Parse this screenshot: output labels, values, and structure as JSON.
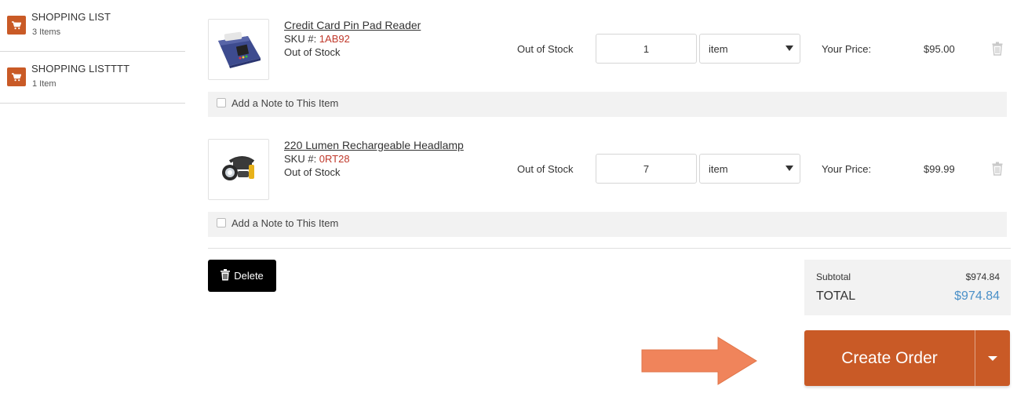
{
  "sidebar": {
    "lists": [
      {
        "name": "SHOPPING LIST",
        "count": "3 Items"
      },
      {
        "name": "SHOPPING LISTTTT",
        "count": "1 Item"
      }
    ]
  },
  "items": [
    {
      "title": "Credit Card Pin Pad Reader",
      "sku_label": "SKU #: ",
      "sku": "1AB92",
      "stock_status": "Out of Stock",
      "stock_column": "Out of Stock",
      "quantity": "1",
      "unit": "item",
      "price_label": "Your Price:",
      "price": "$95.00",
      "note_label": "Add a Note to This Item"
    },
    {
      "title": "220 Lumen Rechargeable Headlamp",
      "sku_label": "SKU #: ",
      "sku": "0RT28",
      "stock_status": "Out of Stock",
      "stock_column": "Out of Stock",
      "quantity": "7",
      "unit": "item",
      "price_label": "Your Price:",
      "price": "$99.99",
      "note_label": "Add a Note to This Item"
    }
  ],
  "actions": {
    "delete_label": "Delete",
    "create_order_label": "Create Order"
  },
  "totals": {
    "subtotal_label": "Subtotal",
    "subtotal": "$974.84",
    "total_label": "TOTAL",
    "total": "$974.84"
  },
  "icons": {
    "cart": "cart-icon",
    "trash": "trash-icon",
    "caret": "chevron-down-icon",
    "annotation": "arrow-right-icon"
  },
  "colors": {
    "accent": "#c95a26",
    "sku": "#c0392b",
    "total": "#4a90c8",
    "arrow": "#f0845b"
  }
}
